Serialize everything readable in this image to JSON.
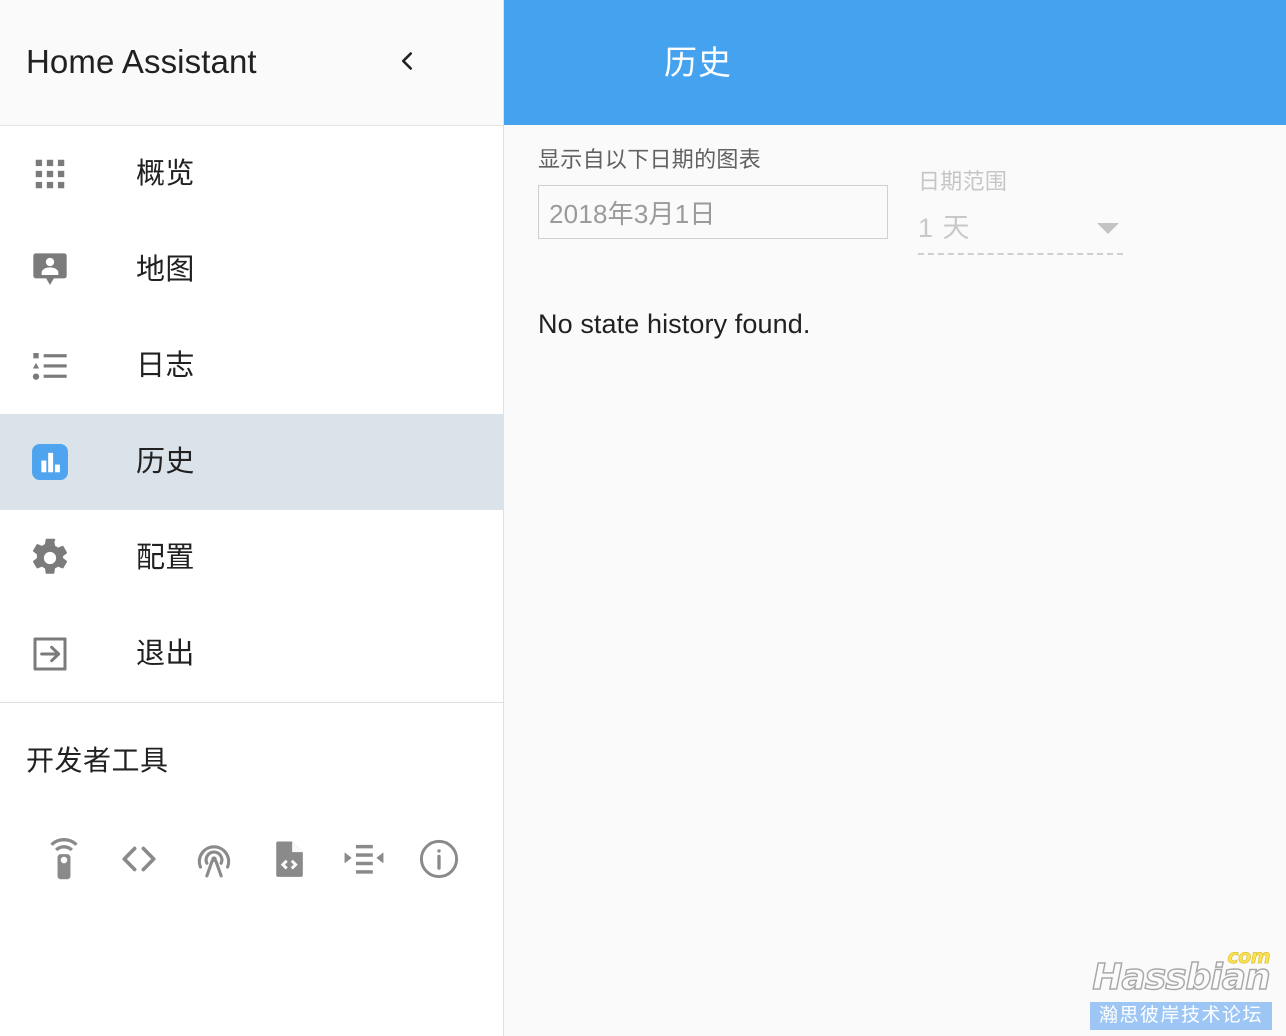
{
  "sidebar": {
    "title": "Home Assistant",
    "collapse_icon": "chevron-left-icon",
    "items": [
      {
        "id": "overview",
        "label": "概览",
        "icon": "apps-grid-icon",
        "selected": false
      },
      {
        "id": "map",
        "label": "地图",
        "icon": "account-pin-icon",
        "selected": false
      },
      {
        "id": "logbook",
        "label": "日志",
        "icon": "format-list-bulleted-icon",
        "selected": false
      },
      {
        "id": "history",
        "label": "历史",
        "icon": "chart-bar-icon",
        "selected": true
      },
      {
        "id": "configuration",
        "label": "配置",
        "icon": "gear-icon",
        "selected": false
      },
      {
        "id": "logout",
        "label": "退出",
        "icon": "exit-to-app-icon",
        "selected": false
      }
    ],
    "devtools": {
      "title": "开发者工具",
      "icons": [
        {
          "id": "states",
          "icon": "remote-icon"
        },
        {
          "id": "template",
          "icon": "code-tags-icon"
        },
        {
          "id": "events",
          "icon": "radio-tower-icon"
        },
        {
          "id": "services",
          "icon": "file-code-icon"
        },
        {
          "id": "mqtt",
          "icon": "mqtt-arrows-icon"
        },
        {
          "id": "info",
          "icon": "information-outline-icon"
        }
      ]
    }
  },
  "main": {
    "toolbar": {
      "title": "历史"
    },
    "date_picker": {
      "label": "显示自以下日期的图表",
      "value": "2018年3月1日",
      "placeholder": "2018年3月1日"
    },
    "range_select": {
      "label": "日期范围",
      "value": "1 天",
      "arrow_icon": "chevron-down-icon",
      "disabled": true
    },
    "empty_message": "No state history found."
  },
  "watermark": {
    "brand": "Hassbian",
    "tld": "com",
    "subtitle": "瀚思彼岸技术论坛"
  },
  "colors": {
    "accent": "#44a2ef",
    "selected_row": "#dbe3ea",
    "sidebar_bg": "#ffffff",
    "content_bg": "#fafafa",
    "text_primary": "#212121",
    "text_secondary": "#616161",
    "icon_gray": "#7b7b7b",
    "disabled_gray": "#c8c8c8"
  }
}
